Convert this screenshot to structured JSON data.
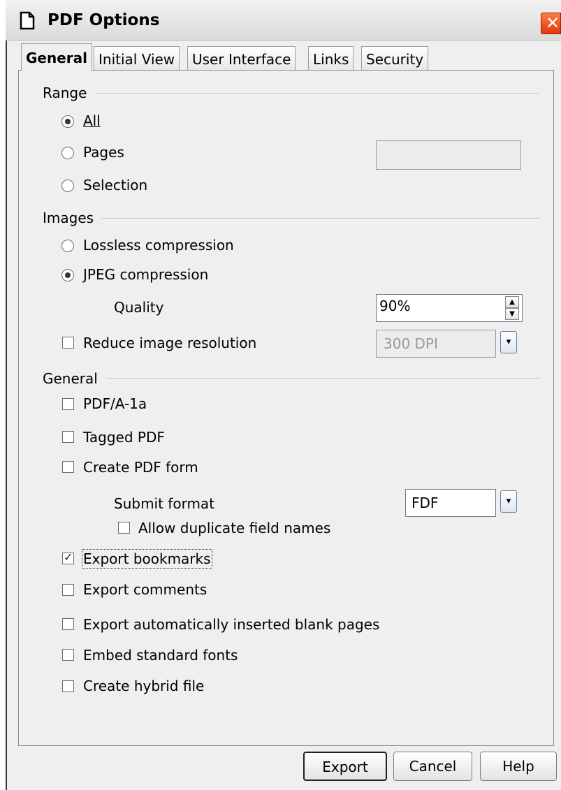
{
  "window": {
    "title": "PDF Options",
    "close_glyph": "✕"
  },
  "tabs": [
    "General",
    "Initial View",
    "User Interface",
    "Links",
    "Security"
  ],
  "range": {
    "header": "Range",
    "all": "All",
    "pages": "Pages",
    "selection": "Selection",
    "selected": "All",
    "pages_value": ""
  },
  "images": {
    "header": "Images",
    "lossless": "Lossless compression",
    "jpeg": "JPEG compression",
    "selected": "JPEG compression",
    "quality_label": "Quality",
    "quality_value": "90%",
    "reduce_label": "Reduce image resolution",
    "reduce_checked": false,
    "resolution_value": "300 DPI"
  },
  "general": {
    "header": "General",
    "pdfa": "PDF/A-1a",
    "tagged": "Tagged PDF",
    "create_form": "Create PDF form",
    "submit_format_label": "Submit format",
    "submit_format_value": "FDF",
    "allow_duplicate": "Allow duplicate field names",
    "export_bookmarks": "Export bookmarks",
    "export_comments": "Export comments",
    "export_blank_pages": "Export automatically inserted blank pages",
    "embed_fonts": "Embed standard fonts",
    "hybrid_file": "Create hybrid file",
    "bookmarks_checked": true
  },
  "buttons": {
    "export": "Export",
    "cancel": "Cancel",
    "help": "Help"
  },
  "icons": {
    "document": "document-icon",
    "spin_up": "▲",
    "spin_down": "▼",
    "dropdown": "▾"
  },
  "colors": {
    "close": "#e03a0a",
    "dialog_bg": "#efefef"
  }
}
